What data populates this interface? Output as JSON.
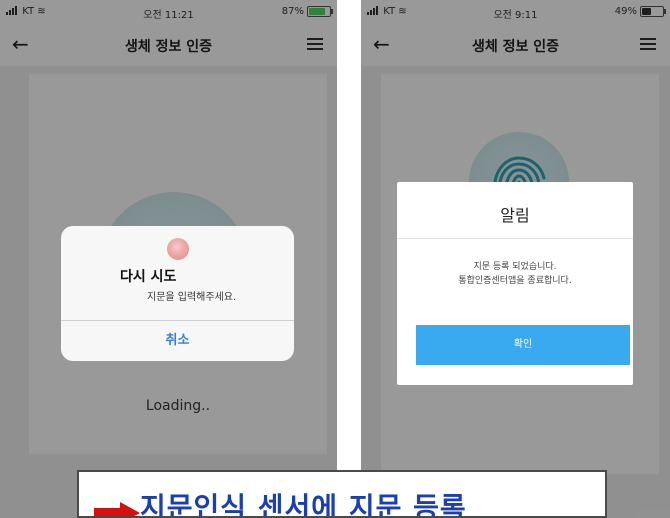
{
  "left_screen": {
    "status": {
      "carrier": "KT",
      "time": "오전 11:21",
      "battery": "87%",
      "battery_level": 0.87,
      "battery_color": "#4cd964"
    },
    "nav": {
      "title": "생체 정보 인증"
    },
    "loading_text": "Loading..",
    "alert": {
      "title": "다시 시도",
      "message": "지문을 입력해주세요.",
      "cancel_label": "취소"
    }
  },
  "right_screen": {
    "status": {
      "carrier": "KT",
      "time": "오전 9:11",
      "battery": "49%",
      "battery_level": 0.49,
      "battery_color": "#333333"
    },
    "nav": {
      "title": "생체 정보 인증"
    },
    "alert": {
      "title": "알림",
      "message_line1": "지문 등록 되었습니다.",
      "message_line2": "통합인증센터앱을 종료합니다.",
      "ok_label": "확인"
    }
  },
  "caption": {
    "text": "지문인식 센서에 지문 등록"
  },
  "colors": {
    "accent_blue": "#3aaaf0",
    "ios_link": "#2f7fe8",
    "caption_text": "#1a3fb0",
    "arrow_red": "#d60f0f"
  }
}
